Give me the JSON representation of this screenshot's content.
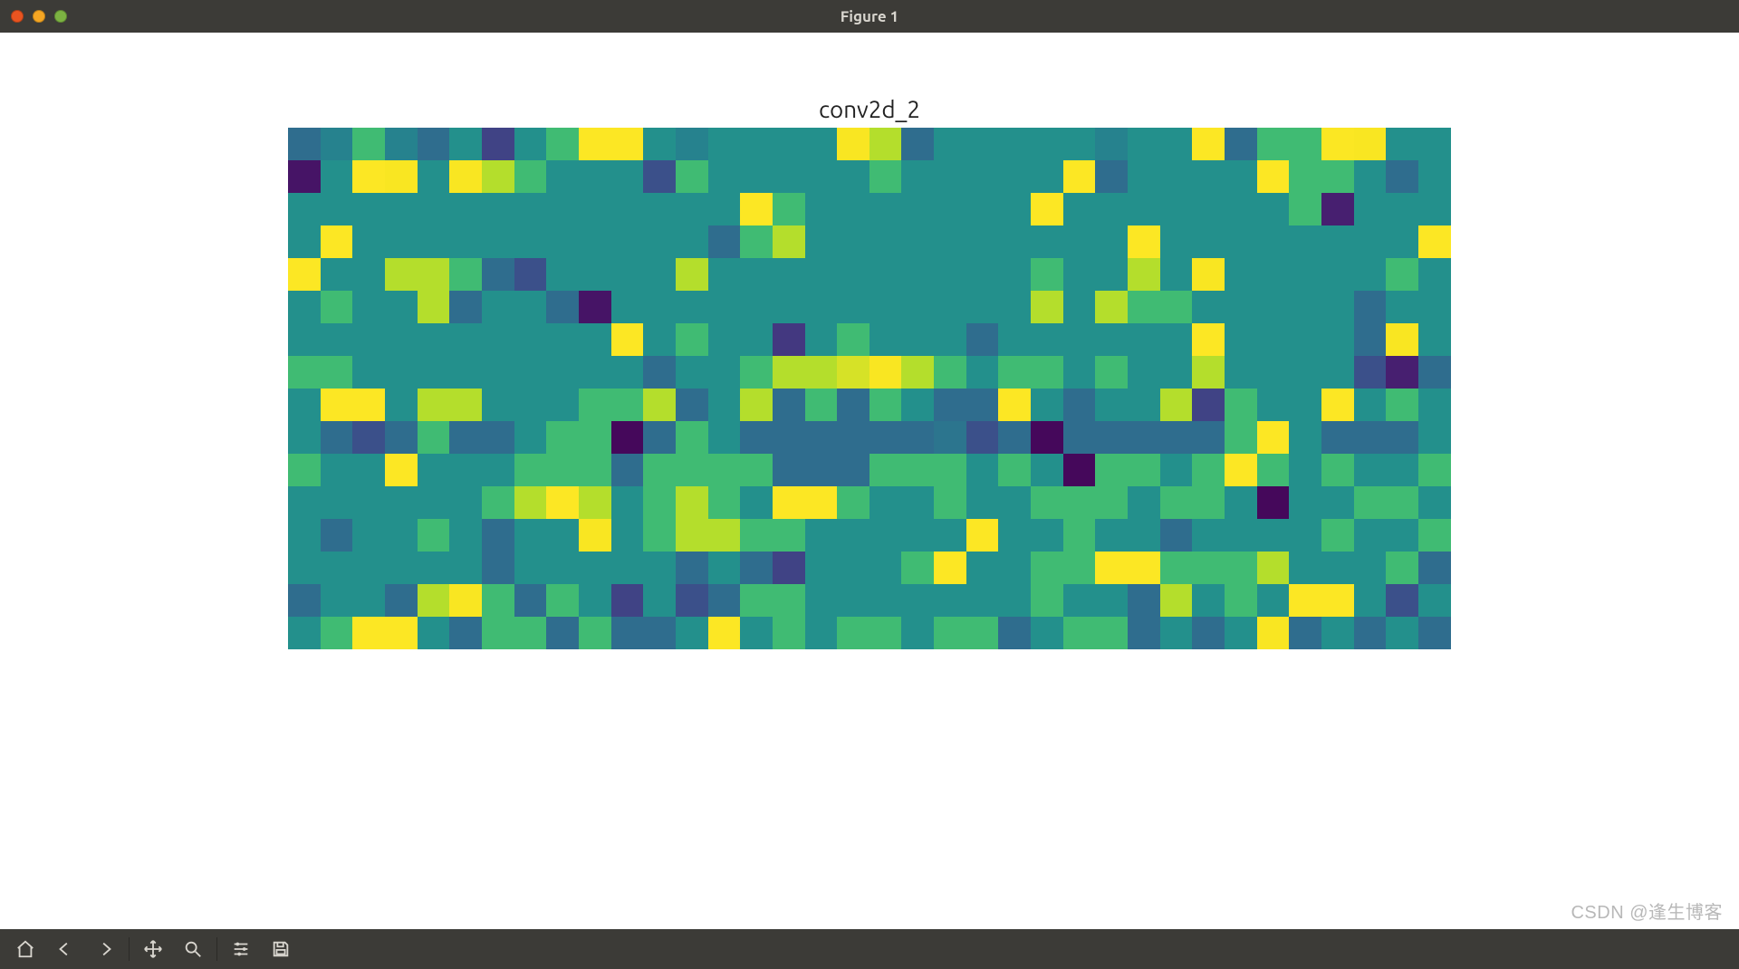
{
  "window": {
    "title": "Figure 1"
  },
  "watermark": "CSDN @逢生博客",
  "toolbar": {
    "home": "Home",
    "back": "Back",
    "fwd": "Forward",
    "pan": "Pan",
    "zoom": "Zoom",
    "config": "Configure subplots",
    "save": "Save"
  },
  "chart_data": {
    "type": "heatmap",
    "title": "conv2d_2",
    "xlabel": "",
    "ylabel": "",
    "rows": 16,
    "cols": 36,
    "colormap": "viridis",
    "value_range": [
      0.0,
      1.0
    ],
    "values": [
      [
        0.32,
        0.4,
        0.62,
        0.4,
        0.32,
        0.45,
        0.18,
        0.45,
        0.62,
        0.98,
        0.98,
        0.45,
        0.4,
        0.45,
        0.45,
        0.45,
        0.45,
        0.92,
        0.8,
        0.32,
        0.45,
        0.45,
        0.45,
        0.45,
        0.45,
        0.4,
        0.45,
        0.45,
        0.98,
        0.32,
        0.62,
        0.62,
        0.95,
        0.92,
        0.45,
        0.45
      ],
      [
        0.05,
        0.45,
        0.98,
        0.92,
        0.45,
        0.92,
        0.8,
        0.62,
        0.45,
        0.45,
        0.45,
        0.22,
        0.62,
        0.45,
        0.45,
        0.45,
        0.45,
        0.45,
        0.62,
        0.45,
        0.45,
        0.45,
        0.45,
        0.45,
        0.98,
        0.32,
        0.45,
        0.45,
        0.45,
        0.45,
        0.98,
        0.62,
        0.62,
        0.45,
        0.32,
        0.45
      ],
      [
        0.45,
        0.45,
        0.45,
        0.45,
        0.45,
        0.45,
        0.45,
        0.45,
        0.45,
        0.45,
        0.45,
        0.45,
        0.45,
        0.45,
        0.98,
        0.62,
        0.45,
        0.45,
        0.45,
        0.45,
        0.45,
        0.45,
        0.45,
        0.98,
        0.45,
        0.45,
        0.45,
        0.45,
        0.45,
        0.45,
        0.45,
        0.62,
        0.08,
        0.45,
        0.45,
        0.45
      ],
      [
        0.45,
        0.98,
        0.45,
        0.45,
        0.45,
        0.45,
        0.45,
        0.45,
        0.45,
        0.45,
        0.45,
        0.45,
        0.45,
        0.32,
        0.62,
        0.8,
        0.45,
        0.45,
        0.45,
        0.45,
        0.45,
        0.45,
        0.45,
        0.45,
        0.45,
        0.45,
        0.98,
        0.45,
        0.45,
        0.45,
        0.45,
        0.45,
        0.45,
        0.45,
        0.45,
        0.98
      ],
      [
        0.98,
        0.45,
        0.45,
        0.8,
        0.8,
        0.62,
        0.32,
        0.22,
        0.45,
        0.45,
        0.45,
        0.45,
        0.8,
        0.45,
        0.45,
        0.45,
        0.45,
        0.45,
        0.45,
        0.45,
        0.45,
        0.45,
        0.45,
        0.62,
        0.45,
        0.45,
        0.8,
        0.45,
        0.92,
        0.45,
        0.45,
        0.45,
        0.45,
        0.45,
        0.62,
        0.45
      ],
      [
        0.45,
        0.62,
        0.45,
        0.45,
        0.8,
        0.32,
        0.45,
        0.45,
        0.32,
        0.05,
        0.45,
        0.45,
        0.45,
        0.45,
        0.45,
        0.45,
        0.45,
        0.45,
        0.45,
        0.45,
        0.45,
        0.45,
        0.45,
        0.8,
        0.45,
        0.8,
        0.62,
        0.62,
        0.45,
        0.45,
        0.45,
        0.45,
        0.45,
        0.32,
        0.45,
        0.45
      ],
      [
        0.45,
        0.45,
        0.45,
        0.45,
        0.45,
        0.45,
        0.45,
        0.45,
        0.45,
        0.45,
        0.98,
        0.45,
        0.62,
        0.45,
        0.45,
        0.15,
        0.45,
        0.62,
        0.45,
        0.45,
        0.45,
        0.32,
        0.45,
        0.45,
        0.45,
        0.45,
        0.45,
        0.45,
        0.98,
        0.45,
        0.45,
        0.45,
        0.45,
        0.32,
        0.92,
        0.45
      ],
      [
        0.62,
        0.62,
        0.45,
        0.45,
        0.45,
        0.45,
        0.45,
        0.45,
        0.45,
        0.45,
        0.45,
        0.32,
        0.45,
        0.45,
        0.62,
        0.8,
        0.8,
        0.85,
        0.92,
        0.8,
        0.62,
        0.45,
        0.62,
        0.62,
        0.45,
        0.62,
        0.45,
        0.45,
        0.8,
        0.45,
        0.45,
        0.45,
        0.45,
        0.22,
        0.08,
        0.32
      ],
      [
        0.45,
        0.98,
        0.98,
        0.45,
        0.8,
        0.8,
        0.45,
        0.45,
        0.45,
        0.62,
        0.62,
        0.8,
        0.32,
        0.45,
        0.8,
        0.32,
        0.62,
        0.32,
        0.62,
        0.45,
        0.32,
        0.32,
        0.98,
        0.45,
        0.32,
        0.45,
        0.45,
        0.8,
        0.18,
        0.62,
        0.45,
        0.45,
        0.98,
        0.45,
        0.62,
        0.45
      ],
      [
        0.45,
        0.32,
        0.22,
        0.32,
        0.62,
        0.32,
        0.32,
        0.45,
        0.62,
        0.62,
        0.02,
        0.32,
        0.62,
        0.45,
        0.32,
        0.32,
        0.32,
        0.32,
        0.32,
        0.32,
        0.35,
        0.22,
        0.32,
        0.02,
        0.32,
        0.32,
        0.32,
        0.32,
        0.32,
        0.62,
        0.98,
        0.45,
        0.32,
        0.32,
        0.32,
        0.45
      ],
      [
        0.62,
        0.45,
        0.45,
        0.98,
        0.45,
        0.45,
        0.45,
        0.62,
        0.62,
        0.62,
        0.32,
        0.62,
        0.62,
        0.62,
        0.62,
        0.32,
        0.32,
        0.32,
        0.62,
        0.62,
        0.62,
        0.45,
        0.62,
        0.45,
        0.02,
        0.62,
        0.62,
        0.45,
        0.62,
        0.98,
        0.62,
        0.45,
        0.62,
        0.45,
        0.45,
        0.62
      ],
      [
        0.45,
        0.45,
        0.45,
        0.45,
        0.45,
        0.45,
        0.62,
        0.8,
        0.98,
        0.8,
        0.45,
        0.62,
        0.8,
        0.62,
        0.45,
        0.98,
        0.98,
        0.62,
        0.45,
        0.45,
        0.62,
        0.45,
        0.45,
        0.62,
        0.62,
        0.62,
        0.45,
        0.62,
        0.62,
        0.45,
        0.02,
        0.45,
        0.45,
        0.62,
        0.62,
        0.45
      ],
      [
        0.45,
        0.32,
        0.45,
        0.45,
        0.62,
        0.45,
        0.32,
        0.45,
        0.45,
        0.92,
        0.45,
        0.62,
        0.8,
        0.8,
        0.62,
        0.62,
        0.45,
        0.45,
        0.45,
        0.45,
        0.45,
        0.98,
        0.45,
        0.45,
        0.62,
        0.45,
        0.45,
        0.32,
        0.45,
        0.45,
        0.45,
        0.45,
        0.62,
        0.45,
        0.45,
        0.62
      ],
      [
        0.45,
        0.45,
        0.45,
        0.45,
        0.45,
        0.45,
        0.32,
        0.45,
        0.45,
        0.45,
        0.45,
        0.45,
        0.32,
        0.45,
        0.32,
        0.18,
        0.45,
        0.45,
        0.45,
        0.62,
        0.98,
        0.45,
        0.45,
        0.62,
        0.62,
        0.98,
        0.98,
        0.62,
        0.62,
        0.62,
        0.8,
        0.45,
        0.45,
        0.45,
        0.62,
        0.32
      ],
      [
        0.32,
        0.45,
        0.45,
        0.32,
        0.8,
        0.92,
        0.62,
        0.32,
        0.62,
        0.45,
        0.18,
        0.45,
        0.22,
        0.32,
        0.62,
        0.62,
        0.45,
        0.45,
        0.45,
        0.45,
        0.45,
        0.45,
        0.45,
        0.62,
        0.45,
        0.45,
        0.32,
        0.8,
        0.45,
        0.62,
        0.45,
        0.98,
        0.98,
        0.45,
        0.22,
        0.45
      ],
      [
        0.45,
        0.62,
        0.98,
        0.98,
        0.45,
        0.32,
        0.62,
        0.62,
        0.32,
        0.62,
        0.32,
        0.32,
        0.45,
        0.98,
        0.45,
        0.62,
        0.45,
        0.62,
        0.62,
        0.45,
        0.62,
        0.62,
        0.32,
        0.45,
        0.62,
        0.62,
        0.32,
        0.45,
        0.32,
        0.45,
        0.92,
        0.32,
        0.45,
        0.32,
        0.45,
        0.32
      ]
    ]
  }
}
